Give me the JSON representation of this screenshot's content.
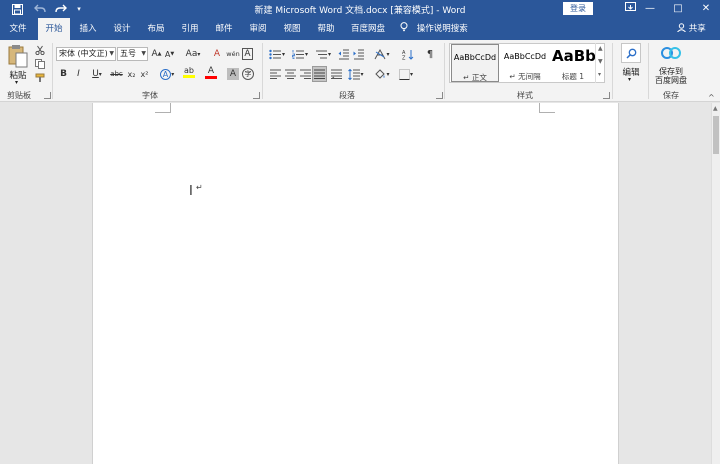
{
  "window": {
    "title": "新建 Microsoft Word 文档.docx [兼容模式] - Word",
    "login_label": "登录",
    "minimize_glyph": "—",
    "restore_glyph": "□",
    "close_glyph": "✕"
  },
  "quick_access": {
    "save_icon": "save-icon",
    "undo_icon": "undo-icon",
    "redo_icon": "redo-icon",
    "customize_icon": "customize-icon"
  },
  "tabs": [
    "文件",
    "开始",
    "插入",
    "设计",
    "布局",
    "引用",
    "邮件",
    "审阅",
    "视图",
    "帮助",
    "百度网盘"
  ],
  "active_tab": "开始",
  "tell_me": "操作说明搜索",
  "share": "共享",
  "ribbon": {
    "clipboard": {
      "paste_label": "粘贴",
      "group_label": "剪贴板"
    },
    "font": {
      "font_name": "宋体 (中文正)",
      "font_size": "五号",
      "grow_glyph": "A",
      "shrink_glyph": "A",
      "case_glyph": "Aa",
      "clear_format_glyph": "A",
      "phonetic_glyph": "wén",
      "border_glyph": "A",
      "bold": "B",
      "italic": "I",
      "underline": "U",
      "strikethrough": "abc",
      "subscript": "x₂",
      "superscript": "x²",
      "effects_glyph": "A",
      "highlight_glyph": "ab",
      "font_color_glyph": "A",
      "shading_glyph": "A",
      "enclose_glyph": "字",
      "group_label": "字体"
    },
    "paragraph": {
      "group_label": "段落"
    },
    "styles": {
      "items": [
        {
          "sample": "AaBbCcDd",
          "name": "↵ 正文"
        },
        {
          "sample": "AaBbCcDd",
          "name": "↵ 无间隔"
        },
        {
          "sample": "AaBb",
          "name": "标题 1"
        }
      ],
      "group_label": "样式"
    },
    "editing": {
      "label": "编辑"
    },
    "save": {
      "label_line1": "保存到",
      "label_line2": "百度网盘",
      "group_label": "保存"
    }
  },
  "document": {
    "paragraph_mark": "↵"
  },
  "colors": {
    "accent": "#2b579a",
    "highlight": "#ffff00",
    "font_color": "#ff0000"
  }
}
